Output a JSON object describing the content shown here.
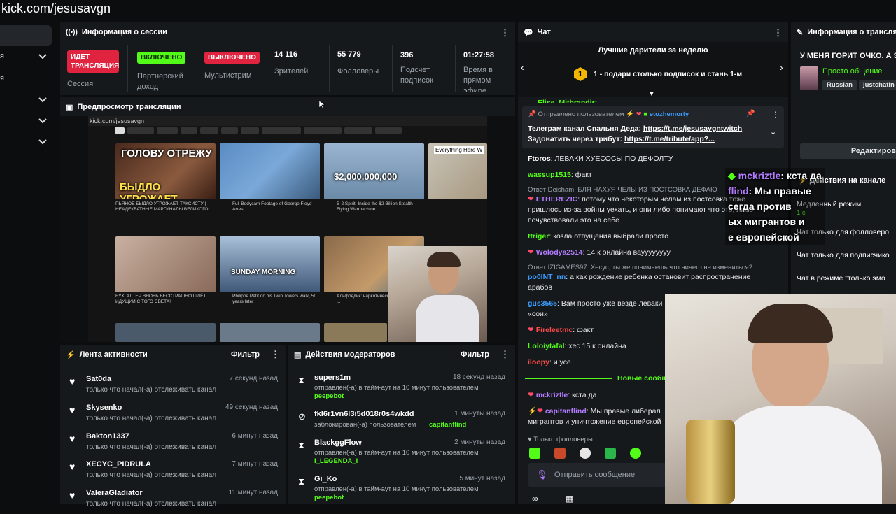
{
  "url_bar": {
    "text": "kick.com/jesusavgn"
  },
  "sidebar": {
    "items": [
      {
        "label": ""
      },
      {
        "label": "я"
      },
      {
        "label": "я"
      }
    ]
  },
  "session": {
    "title": "Информация о сессии",
    "stream_status": "ИДЕТ ТРАНСЛЯЦИЯ",
    "stream_status_label": "Сессия",
    "partner_badge": "ВКЛЮЧЕНО",
    "partner_label": "Партнерский доход",
    "multistream_badge": "ВЫКЛЮЧЕНО",
    "multistream_label": "Мультистрим",
    "viewers_value": "14 116",
    "viewers_label": "Зрителей",
    "followers_value": "55 779",
    "followers_label": "Фолловеры",
    "subs_value": "396",
    "subs_label": "Подсчет подписок",
    "time_value": "01:27:58",
    "time_label": "Время в прямом эфире"
  },
  "preview": {
    "title": "Предпросмотр трансляции",
    "inner_url": "kick.com/jesusavgn",
    "thumb1_text": "ГОЛОВУ ОТРЕЖУ",
    "thumb1_text2": "БЫДЛО УГРОЖАЕТ",
    "thumb3_text": "$2,000,000,000",
    "thumb4_text": "Everything Here W",
    "thumb6_text": "SUNDAY MORNING",
    "captions": [
      "ПЬЯНОЕ БЫДЛО УГРОЖАЕТ ТАКСИСТУ | НЕАДЕКВАТНЫЕ МАРГИНАЛЫ ВЕЛИКОГО",
      "Full Bodycam Footage of George Floyd Arrest",
      "B-2 Spirit: Inside the $2 Billion Stealth Flying Warmachine",
      "БУХГАЛТЕР ВНОВЬ БЕССТРАШНО ШЛЁТ ИДУЩИЙ С ТОГО СВЕТА!",
      "Philippe Petit on his Twin Towers walk, 50 years later",
      "Альфредик: наркотически ..."
    ]
  },
  "activity": {
    "title": "Лента активности",
    "filter": "Фильтр",
    "rows": [
      {
        "name": "Sat0da",
        "desc": "только что начал(-а) отслеживать канал",
        "time": "7 секунд назад"
      },
      {
        "name": "Skysenko",
        "desc": "только что начал(-а) отслеживать канал",
        "time": "49 секунд назад"
      },
      {
        "name": "Bakton1337",
        "desc": "только что начал(-а) отслеживать канал",
        "time": "6 минут назад"
      },
      {
        "name": "XECYC_PIDRULA",
        "desc": "только что начал(-а) отслеживать канал",
        "time": "7 минут назад"
      },
      {
        "name": "ValeraGladiator",
        "desc": "только что начал(-а) отслеживать канал",
        "time": "11 минут назад"
      }
    ]
  },
  "mod": {
    "title": "Действия модераторов",
    "filter": "Фильтр",
    "rows": [
      {
        "name": "supers1m",
        "desc": "отправлен(-а) в тайм-аут на 10 минут пользователем",
        "target": "peepebot",
        "time": "18 секунд назад"
      },
      {
        "name": "fkl6r1vn6l3i5d018r0s4wkdd",
        "desc": "заблокирован(-а) пользователем",
        "target": "capitanflind",
        "time": "1 минуты назад"
      },
      {
        "name": "BlackggFlow",
        "desc": "отправлен(-а) в тайм-аут на 10 минут пользователем",
        "target": "I_LEGENDA_I",
        "time": "2 минуты назад"
      },
      {
        "name": "Gi_Ko",
        "desc": "отправлен(-а) в тайм-аут на 10 минут пользователем",
        "target": "peepebot",
        "time": "5 минут назад"
      }
    ]
  },
  "chat": {
    "title": "Чат",
    "top_gifters": "Лучшие дарители за неделю",
    "gifter_rank": "1",
    "gifter_text": "1 - подари столько подписок и стань 1-м",
    "cut_name": "Elise_Mithrandir:",
    "pinned_header": "Отправлено пользователем",
    "pinned_user": "etozhemorty",
    "pinned_line1_prefix": "Телеграм канал Спальня Деда: ",
    "pinned_line1_link": "https://t.me/jesusavgntwitch",
    "pinned_line2_prefix": "Задонатить через трибут: ",
    "pinned_line2_link": "https://t.me/tribute/app?...",
    "messages": [
      {
        "user": "Ftoros",
        "text": "ЛЕВАКИ ХУЕСОСЫ ПО ДЕФОЛТУ",
        "color": "#ffffff"
      },
      {
        "user": "wassup1515",
        "text": "факт",
        "color": "#53fc18"
      },
      {
        "reply": "Ответ Deisham: БЛЯ НАХУЯ ЧЕЛЫ ИЗ ПОСТСОВКА ДЕФАЮ"
      },
      {
        "user": "ETHEREZIC",
        "text": "потому что некоторым челам из постсовка тоже пришлось из-за войны уехать, и они либо понимают что это, либо почувствовали это на себе",
        "color": "#b37cff"
      },
      {
        "user": "ttriger",
        "text": "козла отпущения выбрали просто",
        "color": "#53fc18"
      },
      {
        "user": "Wolodya2514",
        "text": "14 к онлайна вауууууууу",
        "color": "#b37cff"
      },
      {
        "reply": "Ответ IZIGAMES97: Хесус, ты же понимаешь что ничего не измениться? ..."
      },
      {
        "user": "po0INT_nn",
        "text": "а как рождение ребенка остановит распространение арабов",
        "color": "#3b9cff"
      },
      {
        "user": "gus3565",
        "text": "Вам просто уже везде леваки «сои»",
        "color": "#3b9cff"
      },
      {
        "user": "Fireleetmc",
        "text": "факт",
        "color": "#ff4a4a"
      },
      {
        "user": "Loloiytafal",
        "text": "хес 15 к онлайна",
        "color": "#53fc18"
      },
      {
        "user": "iloopy",
        "text": "и усе",
        "color": "#ff4a4a"
      }
    ],
    "new_messages": "Новые сообщ",
    "after": [
      {
        "user": "mckriztle",
        "text": "кста да",
        "color": "#b37cff"
      },
      {
        "user": "capitanflind",
        "text": "Мы правые либерал мигрантов и уничтожение европейской",
        "color": "#b37cff"
      }
    ],
    "followers_only": "Только фолловеры",
    "input_placeholder": "Отправить сообщение"
  },
  "overlay": {
    "line1_user": "mckriztle",
    "line1_text": ": кста да",
    "line2_user": "flind",
    "line2_text": ": Мы правые",
    "line3": "сегда против",
    "line4": "ых мигрантов и",
    "line5": "е европейской"
  },
  "right": {
    "title": "Информация о трансля",
    "stream_title": "У МЕНЯ ГОРИТ ОЧКО. А З",
    "category": "Просто общение",
    "tag1": "Russian",
    "tag2": "justchatin",
    "edit": "Редактиров",
    "actions_title": "Действия на канале",
    "slow_mode": "Медленный режим",
    "slow_value": "1 с",
    "followers_only": "Чат только для фолловеро",
    "subs_only": "Чат только для подписчико",
    "emote_only": "Чат в режиме \"только эмо"
  }
}
